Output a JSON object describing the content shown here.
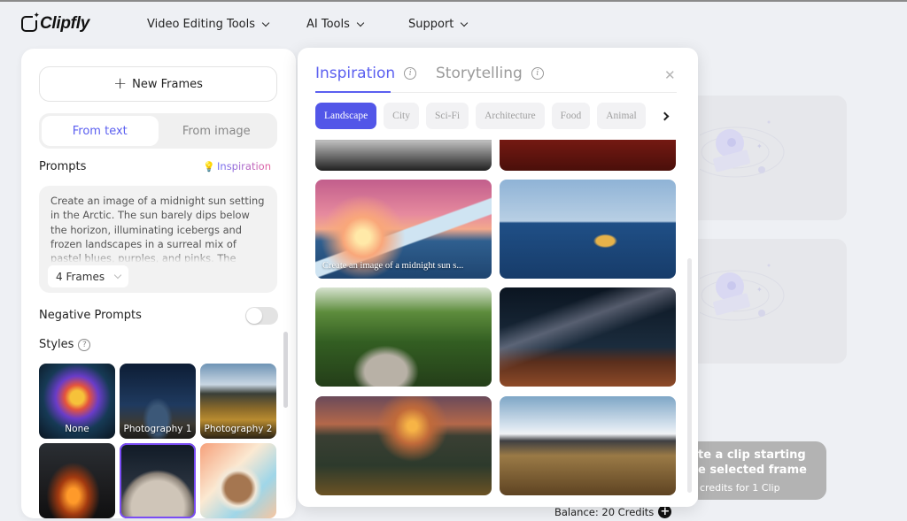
{
  "header": {
    "logo": "Clipfly",
    "nav": [
      {
        "label": "Video Editing Tools"
      },
      {
        "label": "AI Tools"
      },
      {
        "label": "Support"
      }
    ]
  },
  "left_panel": {
    "new_frames_label": "New Frames",
    "mode_tabs": [
      {
        "label": "From text",
        "active": true
      },
      {
        "label": "From image",
        "active": false
      }
    ],
    "prompts_label": "Prompts",
    "inspiration_link": "Inspiration",
    "prompt_text": "Create an image of a midnight sun setting in the Arctic. The sun barely dips below the horizon, illuminating icebergs and frozen landscapes in a surreal mix of pastel blues, purples, and pinks. The tranquil, otherworldly atmosphere...",
    "frames_select": "4 Frames",
    "negative_prompts_label": "Negative Prompts",
    "negative_prompts_enabled": false,
    "styles_label": "Styles",
    "styles": [
      {
        "label": "None",
        "selected": false
      },
      {
        "label": "Photography 1",
        "selected": false
      },
      {
        "label": "Photography 2",
        "selected": false
      },
      {
        "label": "",
        "selected": false
      },
      {
        "label": "",
        "selected": true
      },
      {
        "label": "",
        "selected": false
      }
    ]
  },
  "modal": {
    "tabs": [
      {
        "label": "Inspiration",
        "active": true
      },
      {
        "label": "Storytelling",
        "active": false
      }
    ],
    "categories": [
      {
        "label": "Landscape",
        "active": true
      },
      {
        "label": "City",
        "active": false
      },
      {
        "label": "Sci-Fi",
        "active": false
      },
      {
        "label": "Architecture",
        "active": false
      },
      {
        "label": "Food",
        "active": false
      },
      {
        "label": "Animal",
        "active": false
      }
    ],
    "gallery": [
      {
        "name": "rocky-shore",
        "caption": ""
      },
      {
        "name": "red-planet",
        "caption": ""
      },
      {
        "name": "arctic-midnight-sun",
        "caption": "Create an image of a midnight sun s..."
      },
      {
        "name": "boat-at-sea",
        "caption": ""
      },
      {
        "name": "garden-path",
        "caption": ""
      },
      {
        "name": "milky-way-desert",
        "caption": ""
      },
      {
        "name": "mountain-sunset",
        "caption": ""
      },
      {
        "name": "snowy-mountains-meadow",
        "caption": ""
      }
    ]
  },
  "create_clip": {
    "line1": "te a clip starting",
    "line2": "e selected frame",
    "line3": "credits for 1 Clip"
  },
  "balance": "Balance: 20 Credits",
  "colors": {
    "accent": "#5b5ff0",
    "chip_active": "#5256e8",
    "selected_style_border": "#7a4cf5"
  }
}
